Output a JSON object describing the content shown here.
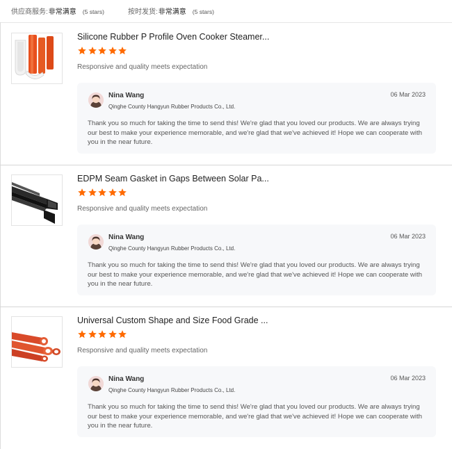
{
  "summary": [
    {
      "label": "供应商服务:",
      "value": "非常满意",
      "stars": "(5 stars)"
    },
    {
      "label": "按时发货:",
      "value": "非常满意",
      "stars": "(5 stars)"
    }
  ],
  "colors": {
    "star": "#ff6a00",
    "reply_bg": "#f7f8fa",
    "divider": "#d6d6d6"
  },
  "reviews": [
    {
      "product_title": "Silicone Rubber P Profile Oven Cooker Steamer...",
      "rating": 5,
      "comment": "Responsive and quality meets expectation",
      "image_icon": "white-orange-silicone-profile",
      "reply": {
        "name": "Nina Wang",
        "company": "Qinghe County Hangyun Rubber Products Co., Ltd.",
        "date": "06 Mar 2023",
        "text": "Thank you so much for taking the time to send this! We're glad that you loved our products. We are always trying our best to make your experience memorable, and we're glad that we've achieved it! Hope we can cooperate with you in the near future."
      }
    },
    {
      "product_title": "EDPM Seam Gasket in Gaps Between Solar Pa...",
      "rating": 5,
      "comment": "Responsive and quality meets expectation",
      "image_icon": "black-epdm-gasket",
      "reply": {
        "name": "Nina Wang",
        "company": "Qinghe County Hangyun Rubber Products Co., Ltd.",
        "date": "06 Mar 2023",
        "text": "Thank you so much for taking the time to send this! We're glad that you loved our products. We are always trying our best to make your experience memorable, and we're glad that we've achieved it! Hope we can cooperate with you in the near future."
      }
    },
    {
      "product_title": "Universal Custom Shape and Size Food Grade ...",
      "rating": 5,
      "comment": "Responsive and quality meets expectation",
      "image_icon": "red-silicone-tubes",
      "reply": {
        "name": "Nina Wang",
        "company": "Qinghe County Hangyun Rubber Products Co., Ltd.",
        "date": "06 Mar 2023",
        "text": "Thank you so much for taking the time to send this! We're glad that you loved our products. We are always trying our best to make your experience memorable, and we're glad that we've achieved it! Hope we can cooperate with you in the near future."
      }
    }
  ]
}
